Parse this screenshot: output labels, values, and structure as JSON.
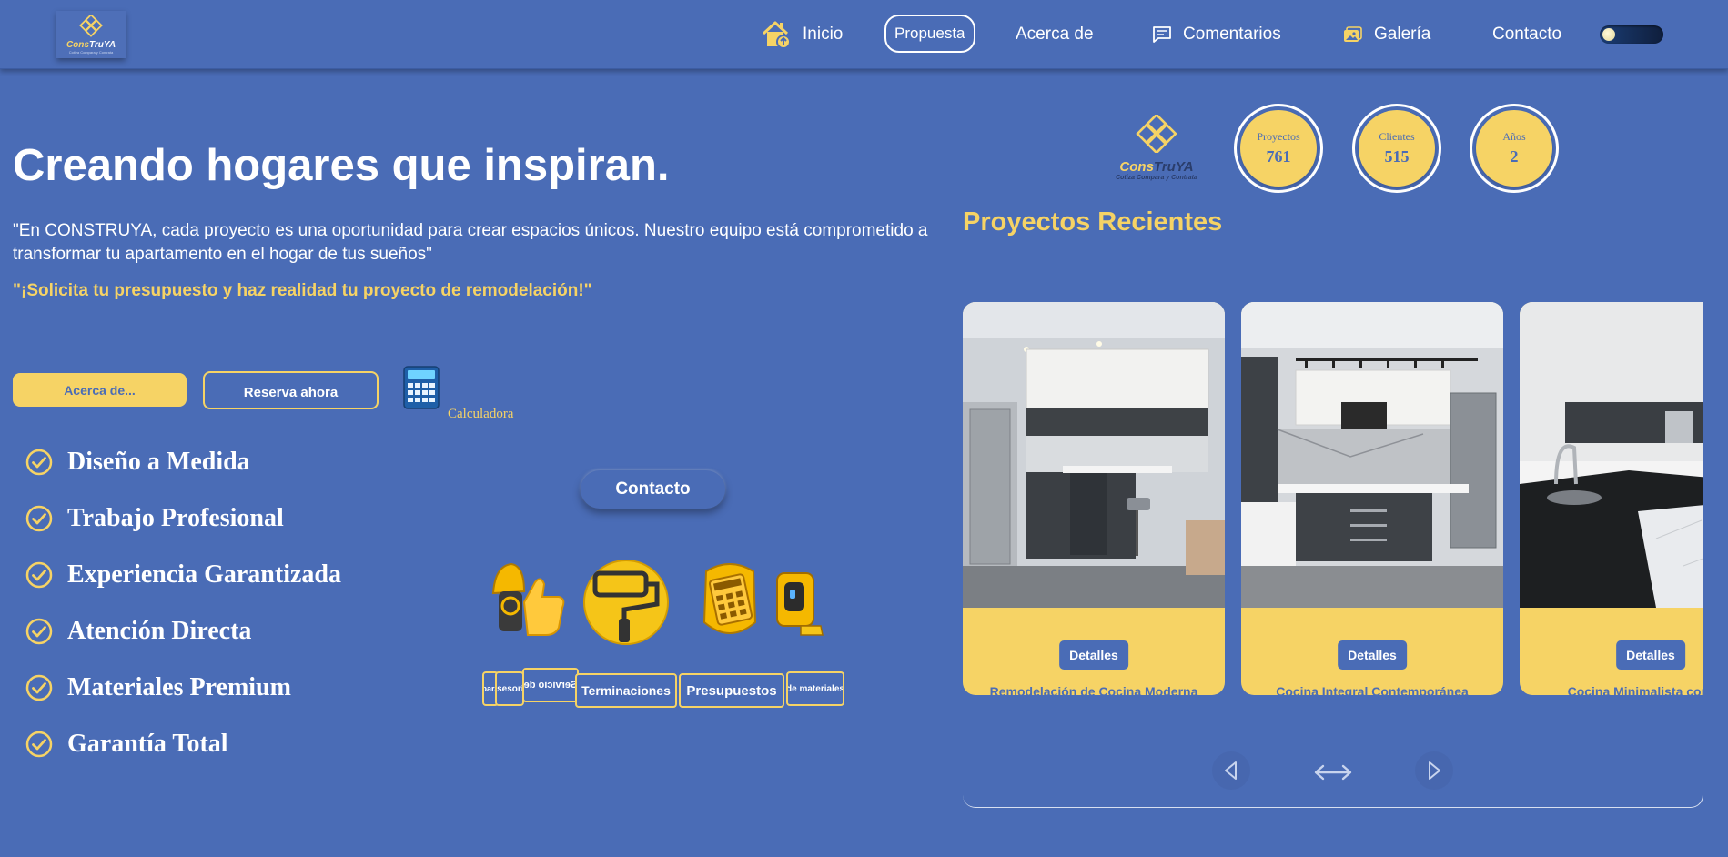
{
  "brand": {
    "logo_part1": "Cons",
    "logo_part2": "Tru",
    "logo_part3": "YA",
    "tagline": "Cotiza Compara y Contrata"
  },
  "nav": {
    "home": "Inicio",
    "proposal": "Propuesta",
    "about": "Acerca de",
    "comments": "Comentarios",
    "gallery": "Galería",
    "contact": "Contacto"
  },
  "hero": {
    "title": "Creando hogares que inspiran.",
    "quote": "\"En CONSTRUYA, cada proyecto es una oportunidad para crear espacios únicos. Nuestro equipo está comprometido a transformar tu apartamento en el hogar de tus sueños\"",
    "cta": "\"¡Solicita tu presupuesto y haz realidad tu proyecto de remodelación!\"",
    "about_button": "Acerca de...",
    "reserve_button": "Reserva ahora",
    "calculator_label": "Calculadora",
    "contact_button": "Contacto"
  },
  "features": [
    "Diseño a Medida",
    "Trabajo Profesional",
    "Experiencia Garantizada",
    "Atención Directa",
    "Materiales Premium",
    "Garantía Total"
  ],
  "service_tags": [
    "para",
    "Asesoría",
    "Servicio de",
    "Terminaciones",
    "Presupuestos",
    "de materiales"
  ],
  "stats": [
    {
      "label": "Proyectos",
      "value": "761"
    },
    {
      "label": "Clientes",
      "value": "515"
    },
    {
      "label": "Años",
      "value": "2"
    }
  ],
  "recent": {
    "title": "Proyectos Recientes",
    "cards": [
      {
        "button": "Detalles",
        "caption": "Remodelación de Cocina Moderna"
      },
      {
        "button": "Detalles",
        "caption": "Cocina Integral Contemporánea"
      },
      {
        "button": "Detalles",
        "caption": "Cocina Minimalista con Isla"
      }
    ]
  },
  "colors": {
    "background": "#4a6cb6",
    "accent_yellow": "#f6d365",
    "white": "#ffffff"
  }
}
